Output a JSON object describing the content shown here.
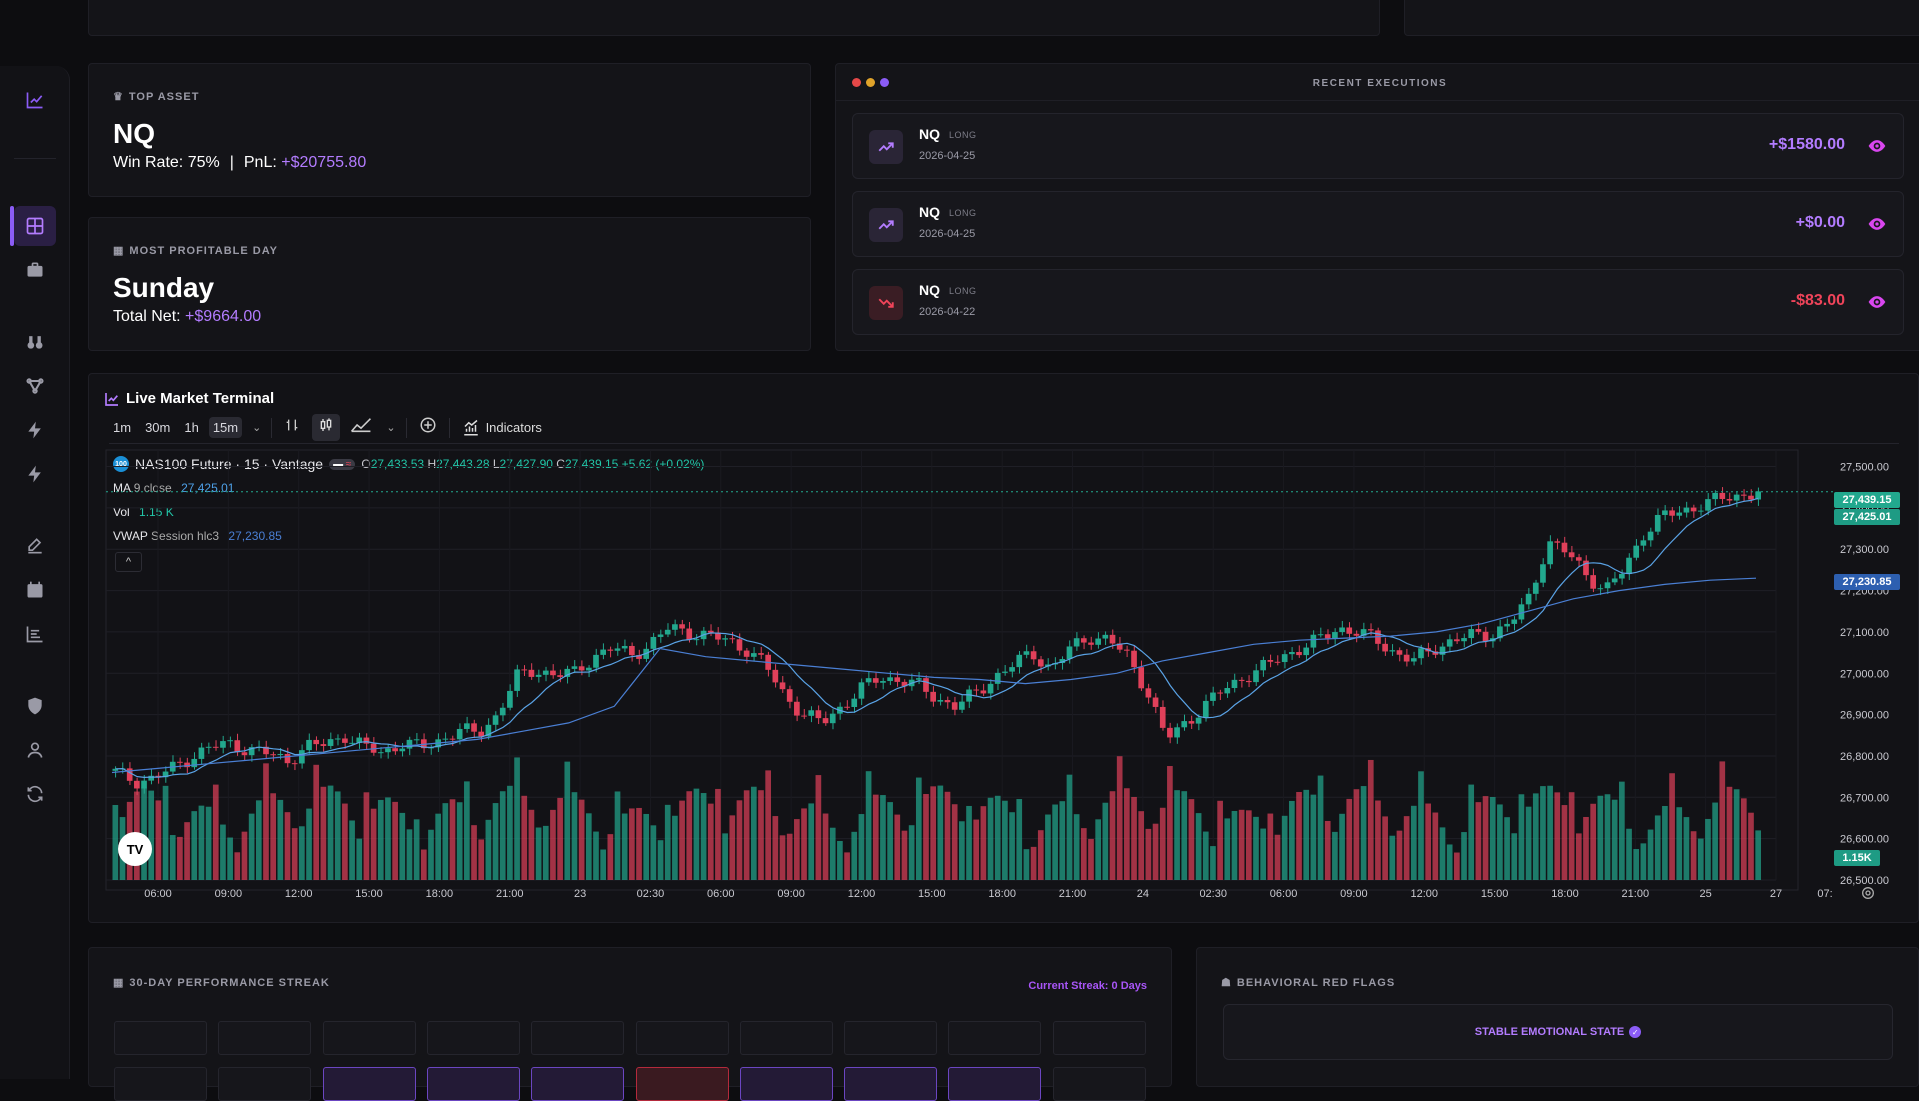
{
  "top_asset": {
    "label": "TOP ASSET",
    "symbol": "NQ",
    "win_rate_label": "Win Rate: 75%",
    "separator": "|",
    "pnl_label": "PnL:",
    "pnl_value": "+$20755.80"
  },
  "profitable_day": {
    "label": "MOST PROFITABLE DAY",
    "day": "Sunday",
    "net_label": "Total Net:",
    "net_value": "+$9664.00"
  },
  "executions": {
    "title": "RECENT EXECUTIONS",
    "items": [
      {
        "symbol": "NQ",
        "direction": "LONG",
        "date": "2026-04-25",
        "pnl": "+$1580.00",
        "outcome": "win"
      },
      {
        "symbol": "NQ",
        "direction": "LONG",
        "date": "2026-04-25",
        "pnl": "+$0.00",
        "outcome": "win"
      },
      {
        "symbol": "NQ",
        "direction": "LONG",
        "date": "2026-04-22",
        "pnl": "-$83.00",
        "outcome": "loss"
      }
    ]
  },
  "terminal": {
    "title": "Live Market Terminal",
    "timeframes": [
      "1m",
      "30m",
      "1h",
      "15m"
    ],
    "active_timeframe": "15m",
    "indicators_label": "Indicators",
    "instrument": "NAS100 Future · 15 · Vantage",
    "instrument_badge": "100",
    "ohlc": {
      "o_label": "O",
      "o": "27,433.53",
      "h_label": "H",
      "h": "27,443.28",
      "l_label": "L",
      "l": "27,427.90",
      "c_label": "C",
      "c": "27,439.15",
      "change": "+5.62 (+0.02%)"
    },
    "ma": {
      "label": "MA",
      "params": "9 close",
      "value": "27,425.01"
    },
    "vol": {
      "label": "Vol",
      "value": "1.15 K"
    },
    "vwap": {
      "label": "VWAP",
      "params": "Session hlc3",
      "value": "27,230.85"
    },
    "tags": {
      "last": "27,439.15",
      "ma": "27,425.01",
      "vwap": "27,230.85",
      "vol": "1.15K"
    },
    "logo": "TV"
  },
  "chart_data": {
    "type": "candlestick",
    "y_ticks": [
      "27,500.00",
      "27,400.00",
      "27,300.00",
      "27,200.00",
      "27,100.00",
      "27,000.00",
      "26,900.00",
      "26,800.00",
      "26,700.00",
      "26,600.00",
      "26,500.00"
    ],
    "ylim": [
      26500,
      27540
    ],
    "x_ticks": [
      "06:00",
      "09:00",
      "12:00",
      "15:00",
      "18:00",
      "21:00",
      "23",
      "02:30",
      "06:00",
      "09:00",
      "12:00",
      "15:00",
      "18:00",
      "21:00",
      "24",
      "02:30",
      "06:00",
      "09:00",
      "12:00",
      "15:00",
      "18:00",
      "21:00",
      "25",
      "27",
      "07:"
    ],
    "close_path": [
      26760,
      26740,
      26745,
      26770,
      26800,
      26820,
      26830,
      26815,
      26805,
      26790,
      26820,
      26830,
      26850,
      26820,
      26810,
      26830,
      26820,
      26840,
      26860,
      26855,
      26900,
      26990,
      27010,
      26995,
      27000,
      27040,
      27060,
      27045,
      27070,
      27110,
      27100,
      27090,
      27080,
      27060,
      27020,
      26950,
      26900,
      26880,
      26920,
      26960,
      26990,
      26985,
      26970,
      26940,
      26920,
      26950,
      26990,
      27020,
      27050,
      27010,
      27060,
      27090,
      27080,
      27040,
      26960,
      26840,
      26880,
      26920,
      26960,
      26990,
      27010,
      27040,
      27060,
      27080,
      27110,
      27100,
      27080,
      27050,
      27030,
      27060,
      27080,
      27090,
      27095,
      27120,
      27180,
      27320,
      27290,
      27240,
      27200,
      27250,
      27340,
      27380,
      27390,
      27410,
      27420,
      27430,
      27440
    ],
    "vwap_line": [
      26760,
      26770,
      26780,
      26790,
      26800,
      26810,
      26820,
      26830,
      26840,
      26860,
      26880,
      26920,
      27060,
      27040,
      27030,
      27020,
      27010,
      27000,
      26990,
      26985,
      26975,
      26985,
      27000,
      27030,
      27050,
      27070,
      27080,
      27085,
      27090,
      27100,
      27120,
      27150,
      27180,
      27200,
      27215,
      27225,
      27230
    ]
  },
  "streak": {
    "label": "30-DAY PERFORMANCE STREAK",
    "current": "Current Streak: 0 Days"
  },
  "red_flags": {
    "label": "BEHAVIORAL RED FLAGS",
    "state": "STABLE EMOTIONAL STATE"
  },
  "colors": {
    "accent": "#8b5cf6",
    "green": "#22c7a9",
    "red": "#f0445a",
    "vwap": "#4a7fd4"
  }
}
